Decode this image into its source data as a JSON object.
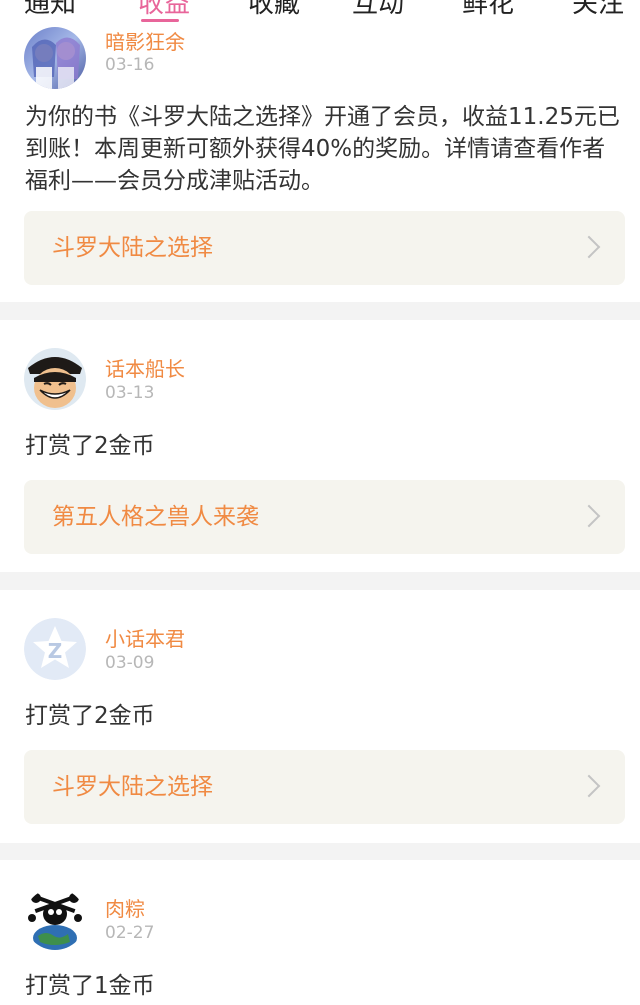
{
  "tabs": [
    {
      "label": "通知"
    },
    {
      "label": "收益"
    },
    {
      "label": "收藏"
    },
    {
      "label": "互动"
    },
    {
      "label": "鲜花"
    },
    {
      "label": "关注"
    }
  ],
  "active_tab": "收益",
  "notifications": [
    {
      "user": "暗影狂余",
      "date": "03-16",
      "message": "为你的书《斗罗大陆之选择》开通了会员，收益11.25元已到账！本周更新可额外获得40%的奖励。详情请查看作者福利——会员分成津贴活动。",
      "book": "斗罗大陆之选择",
      "avatar_icon": "anime-girls-avatar"
    },
    {
      "user": "话本船长",
      "date": "03-13",
      "message": "打赏了2金币",
      "book": "第五人格之兽人来袭",
      "avatar_icon": "straw-hat-boy-avatar"
    },
    {
      "user": "小话本君",
      "date": "03-09",
      "message": "打赏了2金币",
      "book": "斗罗大陆之选择",
      "avatar_icon": "default-star-z-avatar"
    },
    {
      "user": "肉粽",
      "date": "02-27",
      "message": "打赏了1金币",
      "book": "",
      "avatar_icon": "skull-earth-avatar"
    }
  ],
  "colors": {
    "accent_pink": "#e8659a",
    "accent_orange": "#f08a43",
    "book_bg": "#f5f4ee",
    "separator": "#f3f3f3"
  }
}
